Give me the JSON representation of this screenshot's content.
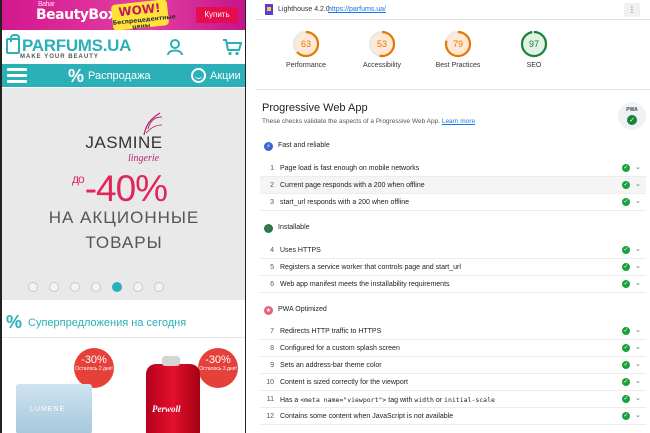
{
  "mobile": {
    "promo": {
      "brand_small": "Bahar",
      "brand": "BeautyBox",
      "wow_big": "WOW!",
      "wow_small": "Беспрецедентные цены",
      "buy_label": "Купить"
    },
    "header": {
      "brand": "PARFUMS.UA",
      "tagline": "MAKE YOUR BEAUTY"
    },
    "nav": {
      "sale_icon": "%",
      "sale_label": "Распродажа",
      "actions_label": "Акции"
    },
    "banner": {
      "brand": "JASMINE",
      "sub": "lingerie",
      "prefix": "до",
      "discount": "-40%",
      "line1": "НА АКЦИОННЫЕ",
      "line2": "ТОВАРЫ",
      "slide_count": 7,
      "active_slide": 5
    },
    "superdeals": {
      "icon": "%",
      "label": "Суперпредложения на сегодня"
    },
    "products": [
      {
        "badge": "-30%",
        "badge_note": "Осталось 2 дня!",
        "name": "LUMENE"
      },
      {
        "badge": "-30%",
        "badge_note": "Осталось 3 дня!",
        "name": "Perwoll"
      }
    ]
  },
  "lighthouse": {
    "version": "Lighthouse 4.2.0",
    "url": "https://parfums.ua/",
    "gauges": [
      {
        "score": "63",
        "label": "Performance",
        "value": 63,
        "color": "#e67700"
      },
      {
        "score": "53",
        "label": "Accessibility",
        "value": 53,
        "color": "#e67700"
      },
      {
        "score": "79",
        "label": "Best Practices",
        "value": 79,
        "color": "#e67700"
      },
      {
        "score": "97",
        "label": "SEO",
        "value": 97,
        "color": "#178239"
      }
    ],
    "pwa": {
      "title": "Progressive Web App",
      "desc": "These checks validate the aspects of a Progressive Web App.",
      "learn_more": "Learn more",
      "badge": "PWA"
    },
    "groups": [
      {
        "title": "Fast and reliable",
        "icon_color": "#3c63d6"
      },
      {
        "title": "Installable",
        "icon_color": "#178239"
      },
      {
        "title": "PWA Optimized",
        "icon_color": "#e8607a"
      }
    ],
    "audits": [
      {
        "num": "1",
        "text": "Page load is fast enough on mobile networks"
      },
      {
        "num": "2",
        "text": "Current page responds with a 200 when offline"
      },
      {
        "num": "3",
        "text": "start_url responds with a 200 when offline"
      },
      {
        "num": "4",
        "text": "Uses HTTPS"
      },
      {
        "num": "5",
        "text": "Registers a service worker that controls page and start_url"
      },
      {
        "num": "6",
        "text": "Web app manifest meets the installability requirements"
      },
      {
        "num": "7",
        "text": "Redirects HTTP traffic to HTTPS"
      },
      {
        "num": "8",
        "text": "Configured for a custom splash screen"
      },
      {
        "num": "9",
        "text": "Sets an address-bar theme color"
      },
      {
        "num": "10",
        "text": "Content is sized correctly for the viewport"
      },
      {
        "num": "11",
        "text_pre": "Has a ",
        "code1": "<meta name=\"viewport\">",
        "text_mid": " tag with ",
        "code2": "width",
        "text_mid2": " or ",
        "code3": "initial-scale"
      },
      {
        "num": "12",
        "text": "Contains some content when JavaScript is not available"
      }
    ]
  }
}
